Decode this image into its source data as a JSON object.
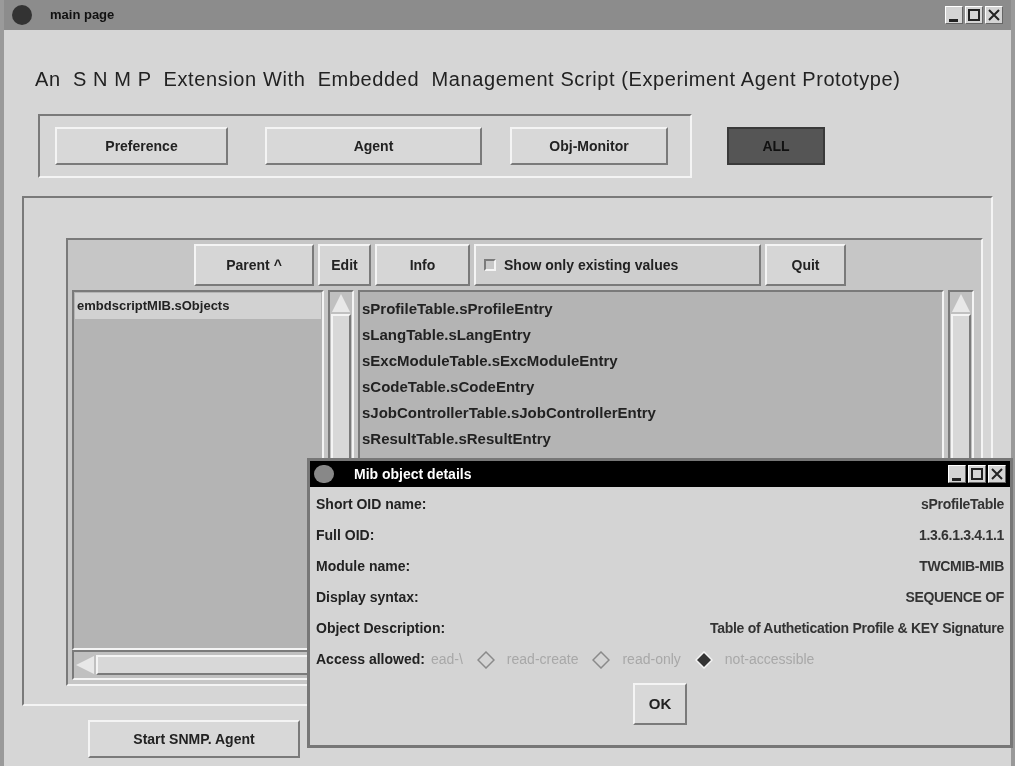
{
  "window": {
    "title": "main page"
  },
  "heading": "An  S N M P  Extension With  Embedded  Management Script (Experiment Agent Prototype)",
  "mode_buttons": [
    {
      "label": "Preference",
      "selected": false
    },
    {
      "label": "Agent",
      "selected": false
    },
    {
      "label": "Obj-Monitor",
      "selected": false
    },
    {
      "label": "ALL",
      "selected": true
    }
  ],
  "browser": {
    "toolbar": [
      {
        "kind": "button",
        "label": "Parent ^"
      },
      {
        "kind": "button",
        "label": "Edit"
      },
      {
        "kind": "button",
        "label": "Info"
      },
      {
        "kind": "checkbox",
        "label": "Show only existing values",
        "checked": false
      },
      {
        "kind": "button",
        "label": "Quit"
      }
    ],
    "path_list": [
      {
        "label": "embdscriptMIB.sObjects",
        "selected": true
      }
    ],
    "object_list": [
      {
        "label": "sProfileTable.sProfileEntry"
      },
      {
        "label": "sLangTable.sLangEntry"
      },
      {
        "label": "sExcModuleTable.sExcModuleEntry"
      },
      {
        "label": "sCodeTable.sCodeEntry"
      },
      {
        "label": "sJobControllerTable.sJobControllerEntry"
      },
      {
        "label": "sResultTable.sResultEntry"
      }
    ]
  },
  "bottom_buttons": [
    "Start SNMP. Agent"
  ],
  "dialog": {
    "title": "Mib object details",
    "fields": [
      {
        "label": "Short OID name:",
        "value": "sProfileTable"
      },
      {
        "label": "Full OID:",
        "value": "1.3.6.1.3.4.1.1"
      },
      {
        "label": "Module name:",
        "value": "TWCMIB-MIB"
      },
      {
        "label": "Display syntax:",
        "value": "SEQUENCE OF"
      },
      {
        "label": "Object Description:",
        "value": "Table of Authetication Profile & KEY Signature"
      }
    ],
    "access_label": "Access allowed:",
    "access_options": [
      {
        "kind": "clipped",
        "label": "ead-\\",
        "disabled": true
      },
      {
        "kind": "radio",
        "label": "read-create",
        "selected": false,
        "disabled": true
      },
      {
        "kind": "radio",
        "label": "read-only",
        "selected": false,
        "disabled": true
      },
      {
        "kind": "radio",
        "label": "not-accessible",
        "selected": true,
        "disabled": true
      }
    ],
    "ok_button": "OK"
  }
}
